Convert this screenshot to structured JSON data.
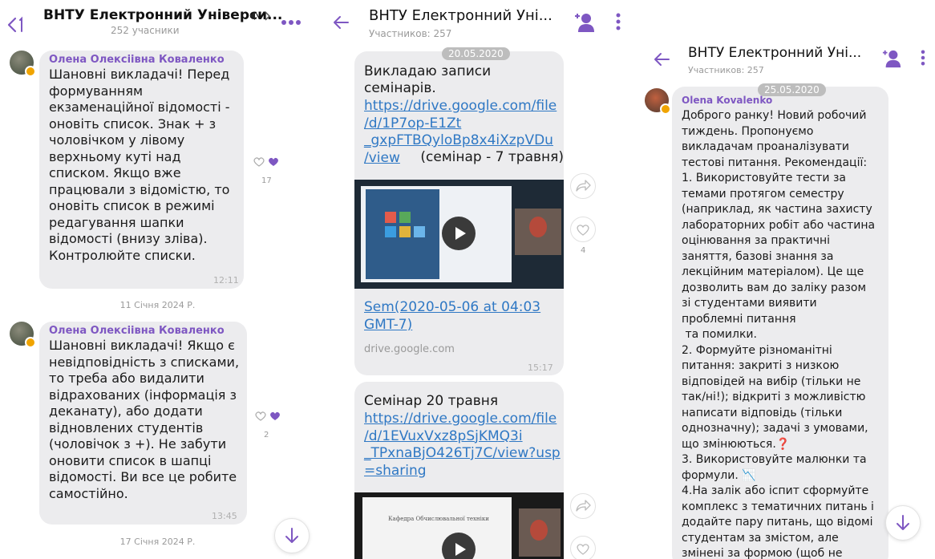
{
  "panel1": {
    "title": "ВНТУ Електронний Універси...",
    "participants": "252 учасники",
    "messages": [
      {
        "sender": "Олена Олексіівна Коваленко",
        "text": "Шановні викладачі! Перед\nформуванням\nекзаменаційної відомості -\nоновіть список. Знак + з\nчоловічком у лівому\nверхньому куті над\nсписком. Якщо вже\nпрацювали з відомістю, то\nоновіть список в режимі\nредагування шапки\nвідомості (внизу зліва).\nКонтролюйте списки.",
        "time": "12:11",
        "likes": "17"
      },
      {
        "sender": "Олена Олексіівна Коваленко",
        "text": "Шановні викладачі! Якщо є\nневідповідність з списками,\nто треба або видалити\nвідрахованих (інформація з\nдеканату), або додати\nвідновлених студентів\n(чоловічок з +). Не забути\nоновити список в шапці\nвідомості. Ви все це робите\nсамостійно.",
        "time": "13:45",
        "likes": "2"
      }
    ],
    "separators": [
      "11 Січня 2024 Р.",
      "17 Січня 2024 Р."
    ]
  },
  "panel2": {
    "title": "ВНТУ Електронний Уні...",
    "participants": "Участников: 257",
    "date": "20.05.2020",
    "msg1": {
      "text": "Викладаю записи\nсемінарів.",
      "link": "https://drive.google.com/file\n/d/1P7op-E1Zt\n_gxpFTBQyloBp8x4iXzpVDu\n/view",
      "suffix": " (семінар - 7 травня)",
      "file_title": "Sem(2020-05-06 at 04:03\nGMT-7)",
      "domain": "drive.google.com",
      "time": "15:17",
      "likes": "4"
    },
    "msg2": {
      "text": "Семінар 20 травня",
      "link": "https://drive.google.com/file\n/d/1EVuxVxz8pSjKMQ3i\n_TPxnaBjO426Tj7C/view?usp\n=sharing",
      "video_caption": "Кафедра Обчислювальної техніки"
    }
  },
  "panel3": {
    "title": "ВНТУ Електронний Уні...",
    "participants": "Участников: 257",
    "date": "25.05.2020",
    "sender": "Olena Kovalenko",
    "text": "Доброго ранку! Новий робочий\nтиждень. Пропонуємо\nвикладачам проаналізувати\nтестові питання. Рекомендації:\n1. Використовуйте тести за\nтемами протягом семестру\n(наприклад, як частина захисту\nлабораторних робіт або частина\nоцінювання за практичні\nзаняття, базові знання за\nлекційним матеріалом). Це ще\nдозволить вам до заліку разом\nзі студентами виявити\nпроблемні питання\n та помилки.\n2. Формуйте різноманітні\nпитання: закриті з низкою\nвідповідей на вибір (тільки не\nтак/ні!); відкриті з можливістю\nнаписати відповідь (тільки\nоднозначну); задачі з умовами,\nщо змінюються.❓\n3. Використовуйте малюнки та\nформули. 📉\n4.На залік або іспит сформуйте\nкомплекс з тематичних питань і\nдодайте пару питань, що відомі\nстудентам за змістом, але\nзмінені за формою (щоб не"
  },
  "colors": {
    "accent": "#7e57c2",
    "link": "#2f78c4",
    "bubble": "#ececee",
    "heart": "#7e57c2"
  }
}
